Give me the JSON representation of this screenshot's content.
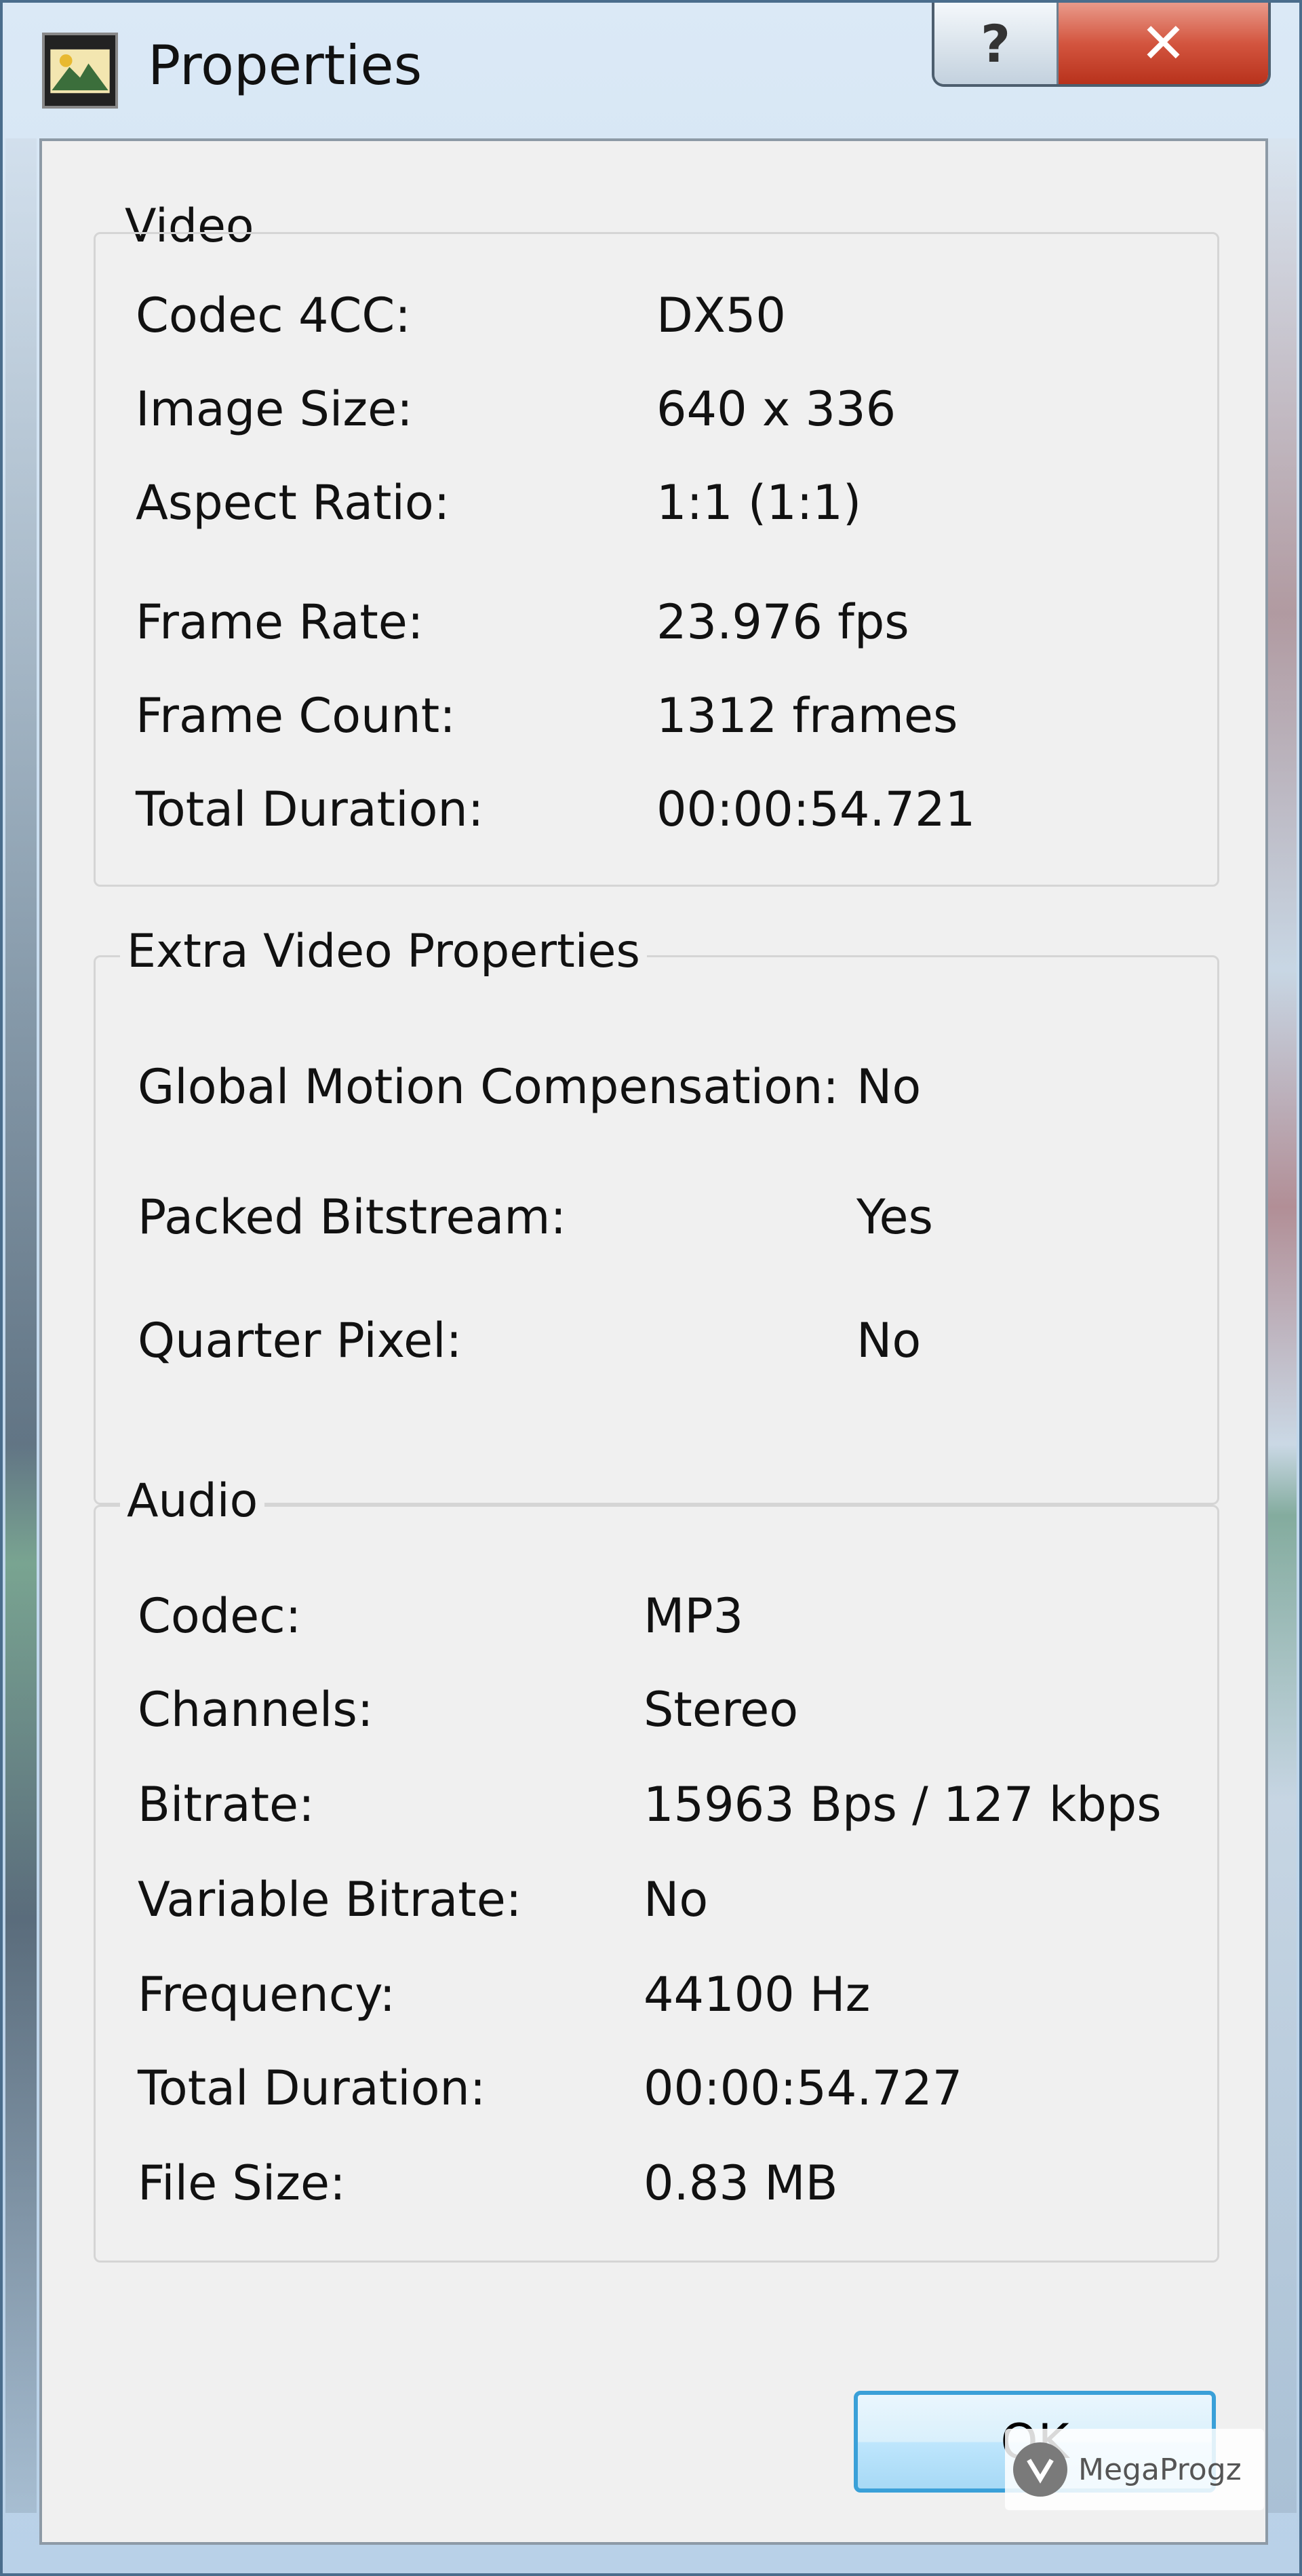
{
  "window": {
    "title": "Properties"
  },
  "caption": {
    "help_glyph": "?",
    "close_glyph": "✕"
  },
  "video": {
    "title": "Video",
    "rows": [
      {
        "label": "Codec 4CC:",
        "value": "DX50"
      },
      {
        "label": "Image Size:",
        "value": "640 x 336"
      },
      {
        "label": "Aspect Ratio:",
        "value": "1:1 (1:1)"
      },
      {
        "label": "Frame Rate:",
        "value": "23.976 fps"
      },
      {
        "label": "Frame Count:",
        "value": "1312 frames"
      },
      {
        "label": "Total Duration:",
        "value": "00:00:54.721"
      }
    ]
  },
  "extra": {
    "title": "Extra Video Properties",
    "rows": [
      {
        "label": "Global Motion Compensation:",
        "value": "No"
      },
      {
        "label": "Packed Bitstream:",
        "value": "Yes"
      },
      {
        "label": "Quarter Pixel:",
        "value": "No"
      }
    ]
  },
  "audio": {
    "title": "Audio",
    "rows": [
      {
        "label": "Codec:",
        "value": "MP3"
      },
      {
        "label": "Channels:",
        "value": "Stereo"
      },
      {
        "label": "Bitrate:",
        "value": "15963 Bps / 127 kbps"
      },
      {
        "label": "Variable Bitrate:",
        "value": "No"
      },
      {
        "label": "Frequency:",
        "value": "44100 Hz"
      },
      {
        "label": "Total Duration:",
        "value": "00:00:54.727"
      },
      {
        "label": "File Size:",
        "value": "0.83 MB"
      }
    ]
  },
  "buttons": {
    "ok_label": "OK"
  },
  "watermark": {
    "text": "MegaProgz"
  },
  "icons": {
    "app": "video-properties-icon",
    "help": "help-icon",
    "close": "close-icon",
    "watermark": "megaprogz-logo"
  }
}
